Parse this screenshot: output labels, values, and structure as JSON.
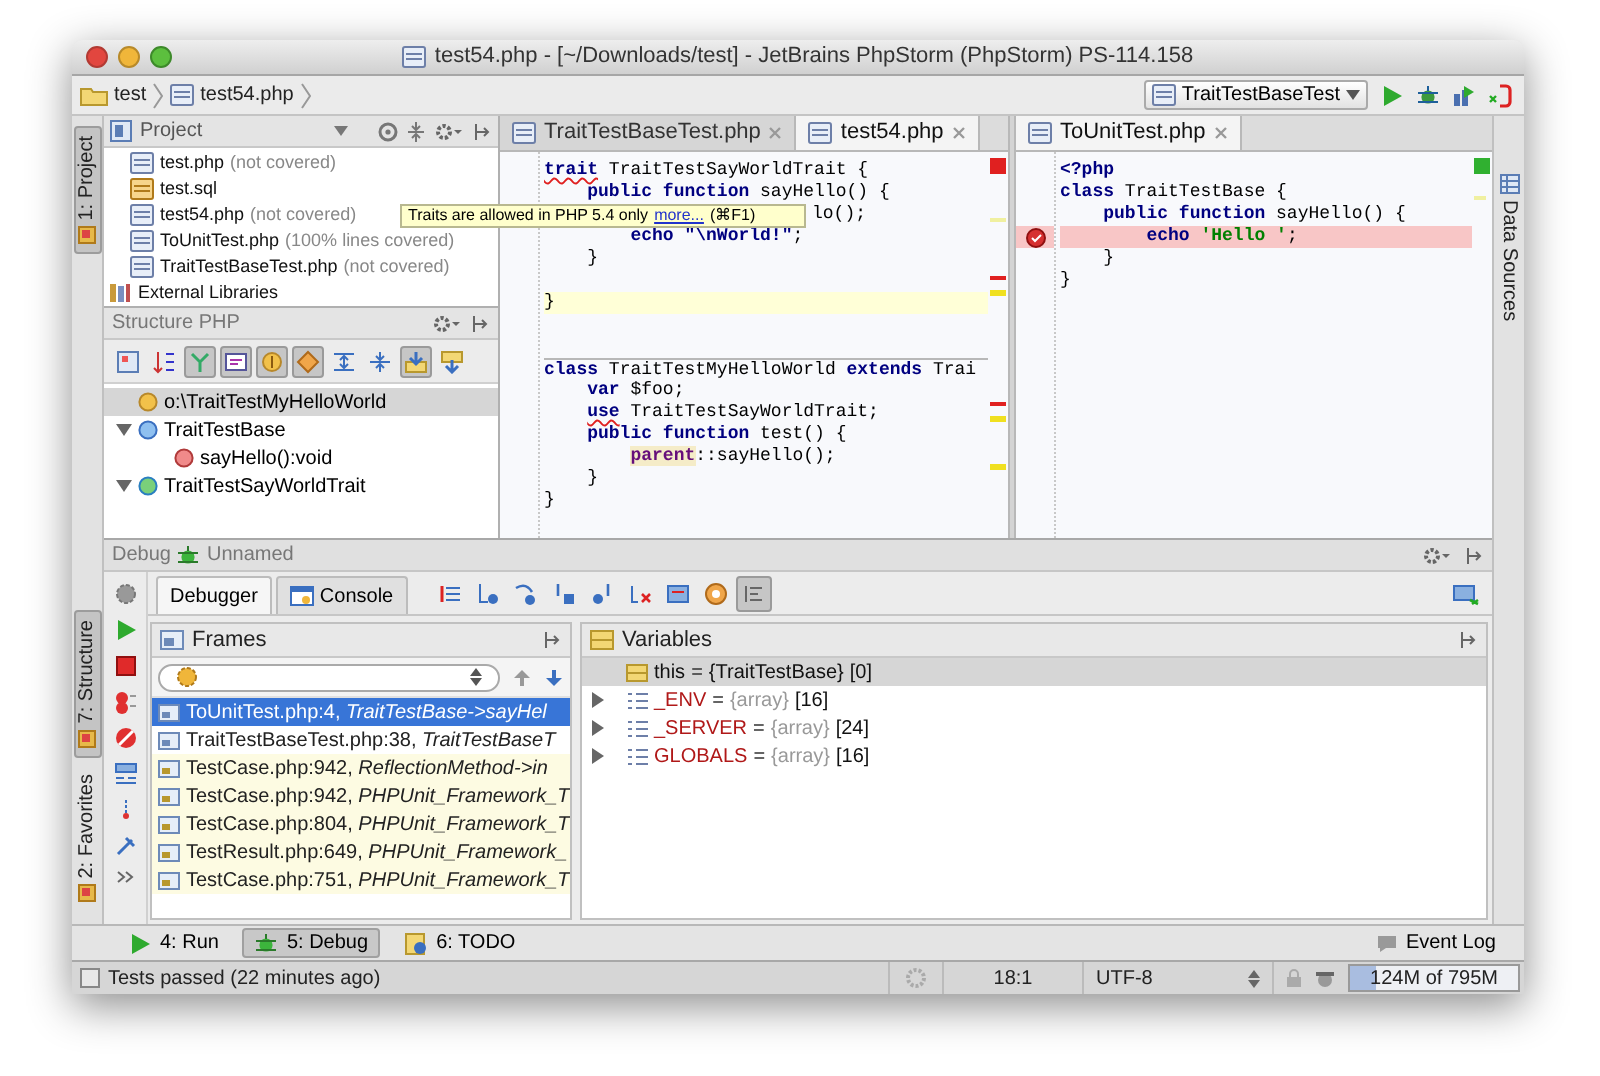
{
  "window": {
    "title": "test54.php - [~/Downloads/test] - JetBrains PhpStorm (PhpStorm) PS-114.158"
  },
  "breadcrumbs": [
    "test",
    "test54.php"
  ],
  "run_config": {
    "label": "TraitTestBaseTest"
  },
  "left_tool_tabs": [
    {
      "label": "1: Project",
      "selected": true,
      "kind": "top"
    },
    {
      "label": "7: Structure",
      "selected": true,
      "kind": "bottom"
    },
    {
      "label": "2: Favorites",
      "selected": false,
      "kind": "bottom"
    }
  ],
  "right_tool_tabs": [
    {
      "label": "Data Sources",
      "selected": false
    }
  ],
  "project": {
    "title": "Project",
    "files": [
      {
        "name": "test.php",
        "note": "(not covered)",
        "kind": "php"
      },
      {
        "name": "test.sql",
        "kind": "sql"
      },
      {
        "name": "test54.php",
        "note": "(not covered)",
        "kind": "php"
      },
      {
        "name": "ToUnitTest.php",
        "note": "(100% lines covered)",
        "kind": "php"
      },
      {
        "name": "TraitTestBaseTest.php",
        "note": "(not covered)",
        "kind": "php"
      },
      {
        "name": "External Libraries",
        "kind": "library"
      }
    ]
  },
  "structure": {
    "title": "Structure PHP",
    "toolbar": [
      {
        "pressed": false
      },
      {
        "pressed": false
      },
      {
        "pressed": true
      },
      {
        "pressed": true
      },
      {
        "pressed": true
      },
      {
        "pressed": true
      },
      {
        "pressed": false
      },
      {
        "pressed": false
      },
      {
        "pressed": true
      },
      {
        "pressed": false
      }
    ],
    "items": [
      {
        "label": "o:\\TraitTestMyHelloWorld",
        "kind": "variable",
        "selected": true
      },
      {
        "label": "TraitTestBase",
        "kind": "class",
        "selected": false,
        "expanded": true,
        "children": [
          {
            "label": "sayHello():void",
            "kind": "method",
            "selected": false
          }
        ]
      },
      {
        "label": "TraitTestSayWorldTrait",
        "kind": "trait",
        "selected": false,
        "expanded": true
      }
    ]
  },
  "tooltip": {
    "text": "Traits are allowed in PHP 5.4 only",
    "link": "more...",
    "shortcut": "(⌘F1)"
  },
  "editors": [
    {
      "tabs": [
        {
          "label": "TraitTestBaseTest.php",
          "selected": false
        },
        {
          "label": "test54.php",
          "selected": true
        }
      ],
      "lines": [
        {
          "kind": "plain",
          "tokens": [
            {
              "kind": "error",
              "text": "trait"
            },
            {
              "kind": "plain",
              "text": " TraitTestSayWorldTrait {"
            }
          ]
        },
        {
          "kind": "plain",
          "tokens": [
            {
              "kind": "keyword",
              "text": "    public function"
            },
            {
              "kind": "plain",
              "text": " sayHello() {"
            }
          ]
        },
        {
          "kind": "covered",
          "tokens": [
            {
              "kind": "plain",
              "text": "lo();"
            }
          ]
        },
        {
          "kind": "plain",
          "tokens": [
            {
              "kind": "keyword",
              "text": "        echo \"\\nWorld!\""
            },
            {
              "kind": "plain",
              "text": ";"
            }
          ]
        },
        {
          "kind": "plain",
          "tokens": [
            {
              "kind": "plain",
              "text": "    }"
            }
          ]
        },
        {
          "kind": "plain"
        },
        {
          "kind": "caret",
          "tokens": [
            {
              "kind": "plain",
              "text": "}"
            }
          ]
        },
        {
          "kind": "plain"
        },
        {
          "kind": "plain"
        },
        {
          "kind": "separated",
          "tokens": [
            {
              "kind": "keyword",
              "text": "class"
            },
            {
              "kind": "plain",
              "text": " TraitTestMyHelloWorld "
            },
            {
              "kind": "keyword",
              "text": "extends"
            },
            {
              "kind": "plain",
              "text": " Trai"
            }
          ]
        },
        {
          "kind": "plain",
          "tokens": [
            {
              "kind": "keyword",
              "text": "    var"
            },
            {
              "kind": "plain",
              "text": " $foo;"
            }
          ]
        },
        {
          "kind": "plain",
          "tokens": [
            {
              "kind": "error",
              "text": "    use"
            },
            {
              "kind": "plain",
              "text": " TraitTestSayWorldTrait;"
            }
          ]
        },
        {
          "kind": "plain",
          "tokens": [
            {
              "kind": "keyword",
              "text": "    public function"
            },
            {
              "kind": "plain",
              "text": " test() {"
            }
          ]
        },
        {
          "kind": "plain",
          "tokens": [
            {
              "kind": "highlight",
              "text": "        parent"
            },
            {
              "kind": "plain",
              "text": "::sayHello();"
            }
          ]
        },
        {
          "kind": "plain",
          "tokens": [
            {
              "kind": "plain",
              "text": "    }"
            }
          ]
        },
        {
          "kind": "plain",
          "tokens": [
            {
              "kind": "plain",
              "text": "}"
            }
          ]
        }
      ]
    },
    {
      "tabs": [
        {
          "label": "ToUnitTest.php",
          "selected": true
        }
      ],
      "lines": [
        {
          "kind": "plain",
          "tokens": [
            {
              "kind": "keyword",
              "text": "<?php"
            }
          ]
        },
        {
          "kind": "plain",
          "tokens": [
            {
              "kind": "keyword",
              "text": "class"
            },
            {
              "kind": "plain",
              "text": " TraitTestBase {"
            }
          ]
        },
        {
          "kind": "plain",
          "tokens": [
            {
              "kind": "keyword",
              "text": "    public function"
            },
            {
              "kind": "plain",
              "text": " sayHello() {"
            }
          ]
        },
        {
          "kind": "breakpoint",
          "tokens": [
            {
              "kind": "keyword",
              "text": "        echo "
            },
            {
              "kind": "string",
              "text": "'Hello '"
            },
            {
              "kind": "plain",
              "text": ";"
            }
          ]
        },
        {
          "kind": "plain",
          "tokens": [
            {
              "kind": "plain",
              "text": "    }"
            }
          ]
        },
        {
          "kind": "plain",
          "tokens": [
            {
              "kind": "plain",
              "text": "}"
            }
          ]
        }
      ]
    }
  ],
  "debug": {
    "title": "Debug",
    "session": "Unnamed",
    "tabs": [
      {
        "label": "Debugger",
        "selected": true
      },
      {
        "label": "Console",
        "selected": false
      }
    ],
    "toolbar": [
      {
        "pressed": false
      },
      {
        "pressed": false
      },
      {
        "pressed": false
      },
      {
        "pressed": false
      },
      {
        "pressed": false
      },
      {
        "pressed": false
      },
      {
        "pressed": false
      },
      {
        "pressed": false
      },
      {
        "pressed": true
      }
    ],
    "frames": {
      "title": "Frames",
      "items": [
        {
          "label": "ToUnitTest.php:4, *TraitTestBase->sayHel*",
          "selected": true,
          "library": false
        },
        {
          "label": "TraitTestBaseTest.php:38, *TraitTestBaseT*",
          "selected": false,
          "library": false
        },
        {
          "label": "TestCase.php:942, *ReflectionMethod->in*",
          "selected": false,
          "library": true
        },
        {
          "label": "TestCase.php:942, *PHPUnit_Framework_T*",
          "selected": false,
          "library": true
        },
        {
          "label": "TestCase.php:804, *PHPUnit_Framework_T*",
          "selected": false,
          "library": true
        },
        {
          "label": "TestResult.php:649, *PHPUnit_Framework_*",
          "selected": false,
          "library": true
        },
        {
          "label": "TestCase.php:751, *PHPUnit_Framework_T*",
          "selected": false,
          "library": true
        }
      ]
    },
    "variables": {
      "title": "Variables",
      "items": [
        {
          "name": "this",
          "operator": "=",
          "value": "{TraitTestBase}",
          "count": "[0]",
          "kind": "object",
          "expandable": false,
          "selected": true
        },
        {
          "name": "_ENV",
          "operator": "=",
          "value": "{array}",
          "count": "[16]",
          "kind": "array",
          "expandable": true,
          "selected": false
        },
        {
          "name": "_SERVER",
          "operator": "=",
          "value": "{array}",
          "count": "[24]",
          "kind": "array",
          "expandable": true,
          "selected": false
        },
        {
          "name": "GLOBALS",
          "operator": "=",
          "value": "{array}",
          "count": "[16]",
          "kind": "array",
          "expandable": true,
          "selected": false
        }
      ]
    }
  },
  "tool_windows": [
    {
      "label": "4: Run",
      "selected": false,
      "kind": "run"
    },
    {
      "label": "5: Debug",
      "selected": true,
      "kind": "debug"
    },
    {
      "label": "6: TODO",
      "selected": false,
      "kind": "todo"
    }
  ],
  "event_log": "Event Log",
  "status_bar": {
    "message": "Tests passed (22 minutes ago)",
    "position": "18:1",
    "encoding": "UTF-8",
    "memory": {
      "text": "124M of 795M",
      "level": 0.16
    }
  }
}
